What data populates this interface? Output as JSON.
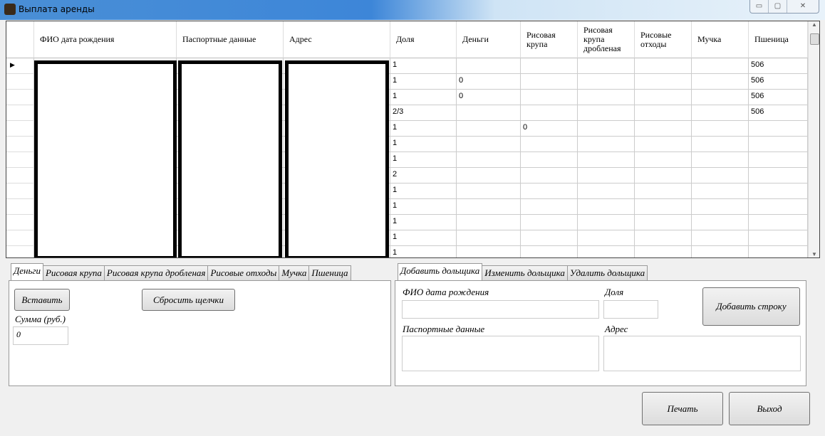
{
  "window": {
    "title": "Выплата аренды",
    "minimize": "▭",
    "maximize": "▢",
    "close": "✕"
  },
  "grid": {
    "columns": [
      "ФИО дата рождения",
      "Паспортные данные",
      "Адрес",
      "Доля",
      "Деньги",
      "Рисовая крупа",
      "Рисовая крупа дробленая",
      "Рисовые отходы",
      "Мучка",
      "Пшеница"
    ],
    "rows": [
      [
        "1",
        "",
        "",
        "",
        "",
        "",
        "506"
      ],
      [
        "1",
        "0",
        "",
        "",
        "",
        "",
        "506"
      ],
      [
        "1",
        "0",
        "",
        "",
        "",
        "",
        "506"
      ],
      [
        "2/3",
        "",
        "",
        "",
        "",
        "",
        "506"
      ],
      [
        "1",
        "",
        "0",
        "",
        "",
        "",
        ""
      ],
      [
        "1",
        "",
        "",
        "",
        "",
        "",
        ""
      ],
      [
        "1",
        "",
        "",
        "",
        "",
        "",
        ""
      ],
      [
        "2",
        "",
        "",
        "",
        "",
        "",
        ""
      ],
      [
        "1",
        "",
        "",
        "",
        "",
        "",
        ""
      ],
      [
        "1",
        "",
        "",
        "",
        "",
        "",
        ""
      ],
      [
        "1",
        "",
        "",
        "",
        "",
        "",
        ""
      ],
      [
        "1",
        "",
        "",
        "",
        "",
        "",
        ""
      ],
      [
        "1",
        "",
        "",
        "",
        "",
        "",
        ""
      ]
    ],
    "current_row_marker": "▶"
  },
  "left_tabs": {
    "tabs": [
      "Деньги",
      "Рисовая крупа",
      "Рисовая крупа дробленая",
      "Рисовые отходы",
      "Мучка",
      "Пшеница"
    ],
    "active": "Деньги",
    "insert_button": "Вставить",
    "reset_button": "Сбросить щелчки",
    "sum_label": "Сумма (руб.)",
    "sum_value": "0"
  },
  "right_tabs": {
    "tabs": [
      "Добавить дольщика",
      "Изменить дольщика",
      "Удалить дольщика"
    ],
    "active": "Добавить дольщика",
    "fio_label": "ФИО дата рождения",
    "share_label": "Доля",
    "passport_label": "Паспортные данные",
    "address_label": "Адрес",
    "add_row_button": "Добавить строку",
    "fio_value": "",
    "share_value": "",
    "passport_value": "",
    "address_value": ""
  },
  "footer": {
    "print_button": "Печать",
    "exit_button": "Выход"
  }
}
